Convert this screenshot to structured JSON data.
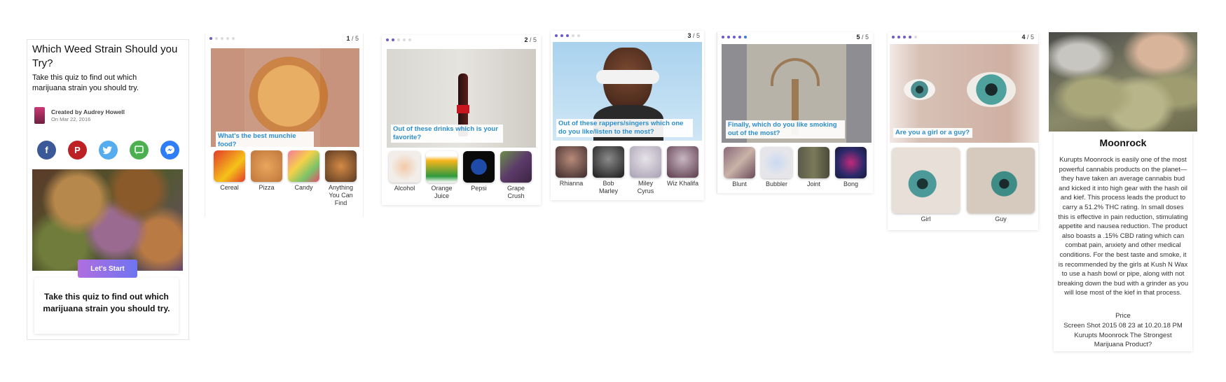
{
  "intro": {
    "title": "Which Weed Strain Should you Try?",
    "subtitle": "Take this quiz to find out which marijuana strain you should try.",
    "author_name": "Created by Audrey Howell",
    "author_date": "On Mar 22, 2016",
    "share_icons": [
      "facebook-icon",
      "pinterest-icon",
      "twitter-icon",
      "sms-icon",
      "messenger-icon"
    ],
    "start_label": "Let's Start",
    "bottom_text": "Take this quiz to find out which marijuana strain you should try."
  },
  "colors": {
    "facebook": "#3b5998",
    "pinterest": "#bd2126",
    "twitter": "#55acee",
    "sms": "#4cb050",
    "messenger": "#2e7ff7",
    "question_text": "#2d8fcf",
    "dot_active": "#6a5acd"
  },
  "cards": [
    {
      "counter_num": "1",
      "counter_total": " / 5",
      "active_dots": 1,
      "question": "What's the best munchie food?",
      "options": [
        "Cereal",
        "Pizza",
        "Candy",
        "Anything You Can Find"
      ]
    },
    {
      "counter_num": "2",
      "counter_total": " / 5",
      "active_dots": 2,
      "question": "Out of these drinks which is your favorite?",
      "options": [
        "Alcohol",
        "Orange Juice",
        "Pepsi",
        "Grape Crush"
      ]
    },
    {
      "counter_num": "3",
      "counter_total": " / 5",
      "active_dots": 3,
      "question": "Out of these rappers/singers which one do you like/listen to the most?",
      "options": [
        "Rhianna",
        "Bob Marley",
        "Miley Cyrus",
        "Wiz Khalifa"
      ]
    },
    {
      "counter_num": "5",
      "counter_total": " / 5",
      "active_dots": 5,
      "question": "Finally, which do you like smoking out of the most?",
      "options": [
        "Blunt",
        "Bubbler",
        "Joint",
        "Bong"
      ]
    },
    {
      "counter_num": "4",
      "counter_total": " / 5",
      "active_dots": 4,
      "question": "Are you a girl or a guy?",
      "options": [
        "Girl",
        "Guy"
      ]
    }
  ],
  "result": {
    "title": "Moonrock",
    "description": "Kurupts Moonrock is easily one of the most powerful cannabis products on the planet—they have taken an average cannabis bud and kicked it into high gear with the hash oil and kief. This process leads the product to carry a 51.2% THC rating. In small doses this is effective in pain reduction, stimulating appetite and nausea reduction. The product also boasts a .15% CBD rating which can combat pain, anxiety and other medical conditions. For the best taste and smoke, it is recommended by the girls at Kush N Wax to use a hash bowl or pipe, along with not breaking down the bud with a grinder as you will lose most of the kief in that process.",
    "price_heading": "Price",
    "price_text": "Screen Shot 2015 08 23 at 10.20.18 PM Kurupts Moonrock The Strongest Marijuana Product?"
  }
}
